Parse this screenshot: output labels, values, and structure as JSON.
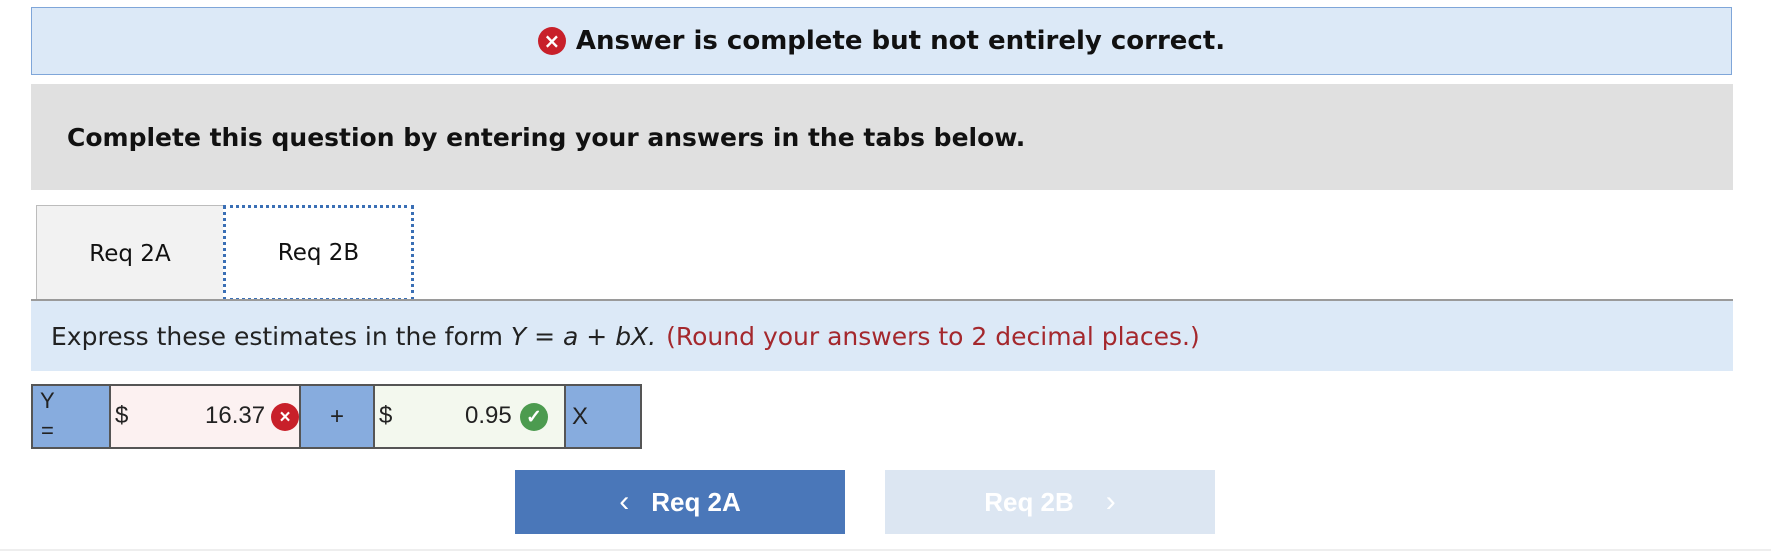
{
  "banner": {
    "icon": "×",
    "text": "Answer is complete but not entirely correct."
  },
  "instructions": {
    "text": "Complete this question by entering your answers in the tabs below."
  },
  "tabs": [
    {
      "label": "Req 2A"
    },
    {
      "label": "Req 2B"
    }
  ],
  "prompt": {
    "prefix": "Express these estimates in the form ",
    "formula_y": "Y",
    "formula_mid": " = ",
    "formula_a": "a",
    "formula_plus": " + ",
    "formula_bx": "bX.",
    "rounding": "(Round your answers to 2 decimal places.)"
  },
  "equation": {
    "y_label": "Y",
    "eq_label": "=",
    "currency_a": "$",
    "a_value": "16.37",
    "a_mark": "×",
    "plus": "+",
    "currency_b": "$",
    "b_value": "0.95",
    "b_mark": "✓",
    "x_label": "X"
  },
  "nav": {
    "prev_label": "Req 2A",
    "prev_chev": "‹",
    "next_label": "Req 2B",
    "next_chev": "›"
  },
  "colors": {
    "wrong": "#c8202a",
    "correct": "#4c9b4f",
    "primary_button": "#4a77b9",
    "disabled_button": "#dce6f2",
    "banner_bg": "#dce9f7"
  }
}
